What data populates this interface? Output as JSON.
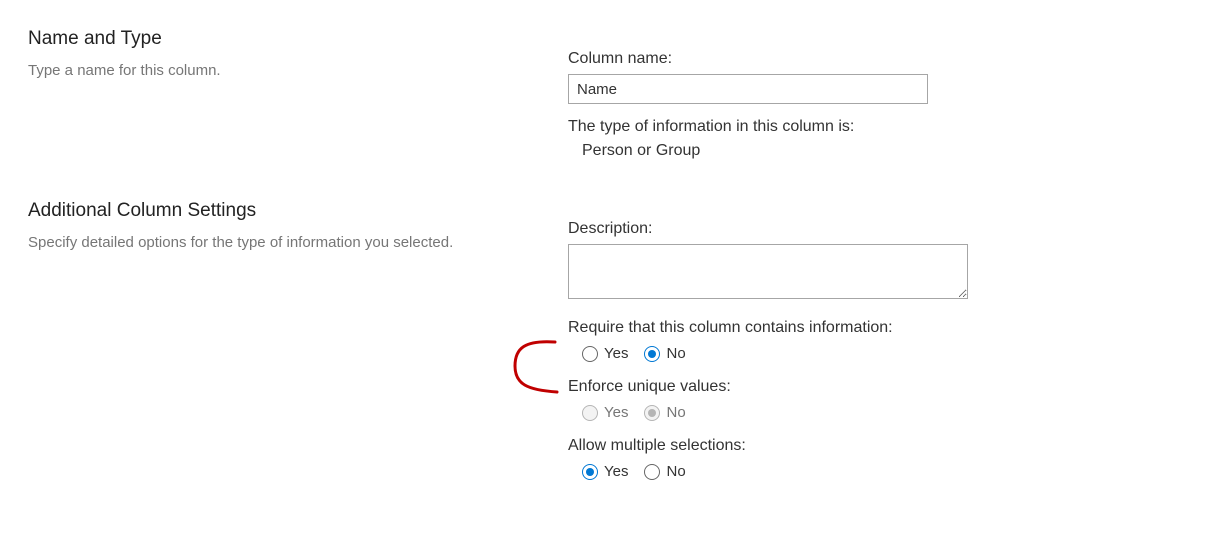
{
  "nameType": {
    "title": "Name and Type",
    "desc": "Type a name for this column.",
    "columnNameLabel": "Column name:",
    "columnNameValue": "Name",
    "typeLabel": "The type of information in this column is:",
    "typeValue": "Person or Group"
  },
  "additional": {
    "title": "Additional Column Settings",
    "desc": "Specify detailed options for the type of information you selected.",
    "descriptionLabel": "Description:",
    "descriptionValue": "",
    "requireLabel": "Require that this column contains information:",
    "requireYes": "Yes",
    "requireNo": "No",
    "uniqueLabel": "Enforce unique values:",
    "uniqueYes": "Yes",
    "uniqueNo": "No",
    "multiLabel": "Allow multiple selections:",
    "multiYes": "Yes",
    "multiNo": "No"
  }
}
